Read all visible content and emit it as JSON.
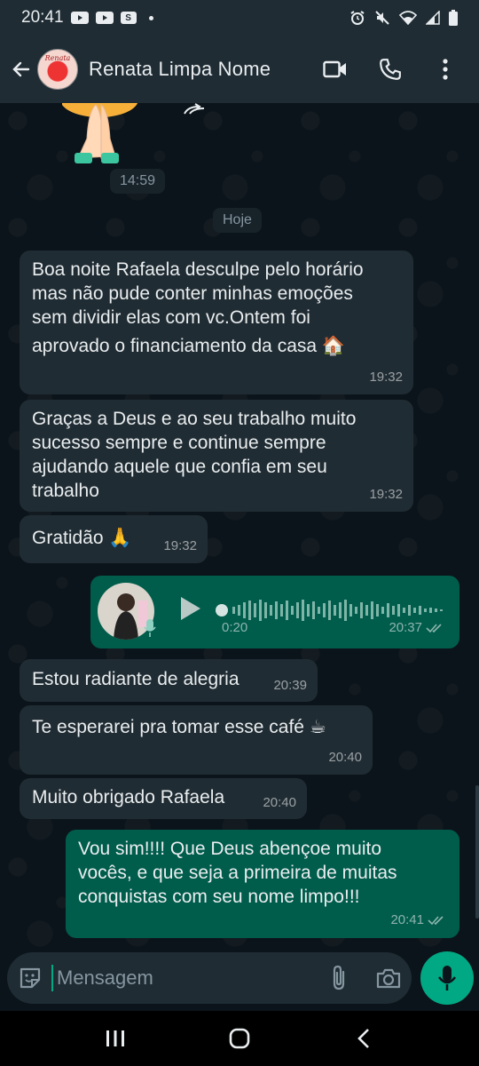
{
  "status_bar": {
    "time": "20:41",
    "s_badge": "S"
  },
  "header": {
    "contact_name": "Renata Limpa Nome",
    "avatar_text": "Renata"
  },
  "chat": {
    "sticker_time": "14:59",
    "date_chip": "Hoje",
    "messages": [
      {
        "dir": "in",
        "lines": [
          "Boa noite Rafaela desculpe pelo horário",
          "mas não pude conter minhas emoções",
          "sem dividir elas com vc.Ontem foi",
          "aprovado o financiamento da casa 🏠"
        ],
        "time": "19:32"
      },
      {
        "dir": "in",
        "lines": [
          "Graças a Deus e ao seu trabalho muito",
          "sucesso sempre e continue sempre",
          "ajudando aquele que confia em seu",
          "trabalho"
        ],
        "time": "19:32"
      },
      {
        "dir": "in",
        "text": "Gratidão 🙏",
        "time": "19:32"
      },
      {
        "dir": "out",
        "type": "voice",
        "duration": "0:20",
        "time": "20:37"
      },
      {
        "dir": "in",
        "text": "Estou radiante de alegria",
        "time": "20:39"
      },
      {
        "dir": "in",
        "text": "Te esperarei pra tomar esse café ☕",
        "time": "20:40"
      },
      {
        "dir": "in",
        "text": "Muito obrigado Rafaela",
        "time": "20:40"
      },
      {
        "dir": "out",
        "lines": [
          "Vou sim!!!! Que Deus abençoe muito",
          "vocês, e que seja a primeira de muitas",
          "conquistas com seu nome limpo!!!"
        ],
        "time": "20:41"
      }
    ]
  },
  "composer": {
    "placeholder": "Mensagem"
  },
  "icons": {
    "back": "arrow-left-icon",
    "video": "video-call-icon",
    "call": "phone-icon",
    "menu": "more-vert-icon",
    "sticker": "sticker-icon",
    "attach": "paperclip-icon",
    "camera": "camera-icon",
    "mic": "mic-icon"
  },
  "colors": {
    "accent": "#00a884",
    "outgoing": "#005c4b",
    "incoming": "#202c33",
    "header": "#1f2c34"
  }
}
